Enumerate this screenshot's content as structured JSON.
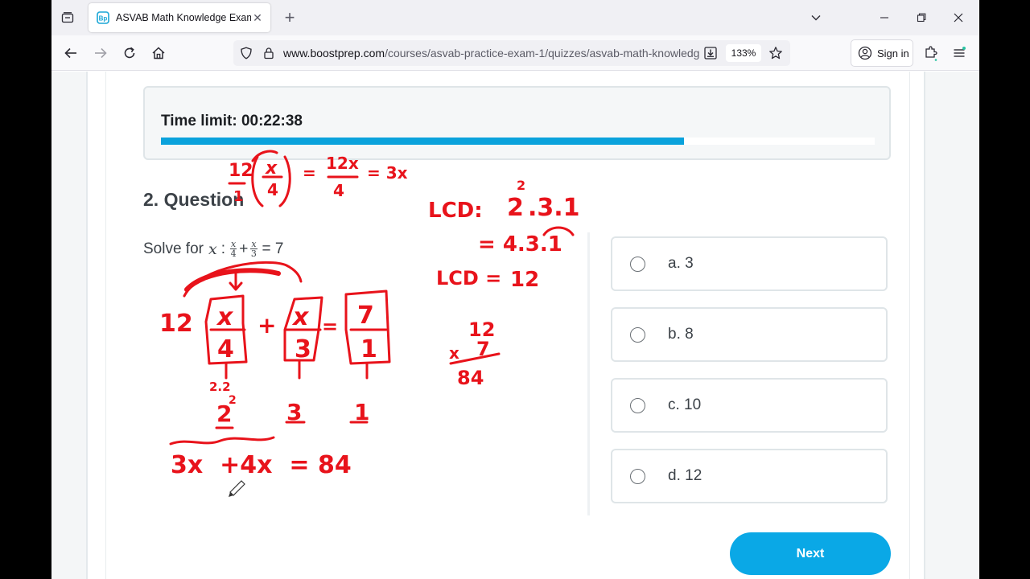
{
  "browser": {
    "tab_title": "ASVAB Math Knowledge Exam",
    "url_host": "www.boostprep.com",
    "url_path": "/courses/asvab-practice-exam-1/quizzes/asvab-math-knowledge",
    "zoom": "133%",
    "sign_in": "Sign in"
  },
  "quiz": {
    "time_limit": "Time limit: 00:22:38",
    "progress_fraction": 0.733,
    "question_title": "2. Question",
    "question_prefix": "Solve for",
    "var": "x",
    "colon": ":",
    "plus": "+",
    "den1": "4",
    "den2": "3",
    "equals": "= 7",
    "options": [
      {
        "label": "a. 3"
      },
      {
        "label": "b. 8"
      },
      {
        "label": "c. 10"
      },
      {
        "label": "d. 12"
      }
    ],
    "next_label": "Next"
  },
  "handwriting": {
    "ink_color": "#e8131b",
    "top_eq": [
      "12",
      "1",
      "x",
      "4",
      "=",
      "12x",
      "4",
      "= 3x"
    ],
    "lcd_line1": "LCD:",
    "lcd_base": "2",
    "lcd_exp": "2",
    "lcd_rest": ".3.1",
    "lcd_line2": "= 4.3.1",
    "lcd_line3": "LCD =",
    "lcd_value": "12",
    "mult_top": "12",
    "mult_times": "x",
    "mult_bottom": "7",
    "mult_result": "84",
    "main_mult": "12",
    "frac1_num": "x",
    "frac1_den": "4",
    "frac2_num": "x",
    "frac2_den": "3",
    "frac3_num": "7",
    "frac3_den": "1",
    "plus": "+",
    "eq": "=",
    "factor_small": "2.2",
    "factor1": "2",
    "factor1_exp": "2",
    "factor2": "3",
    "factor3": "1",
    "bottom_eq": "3x  +4x  = 84"
  }
}
